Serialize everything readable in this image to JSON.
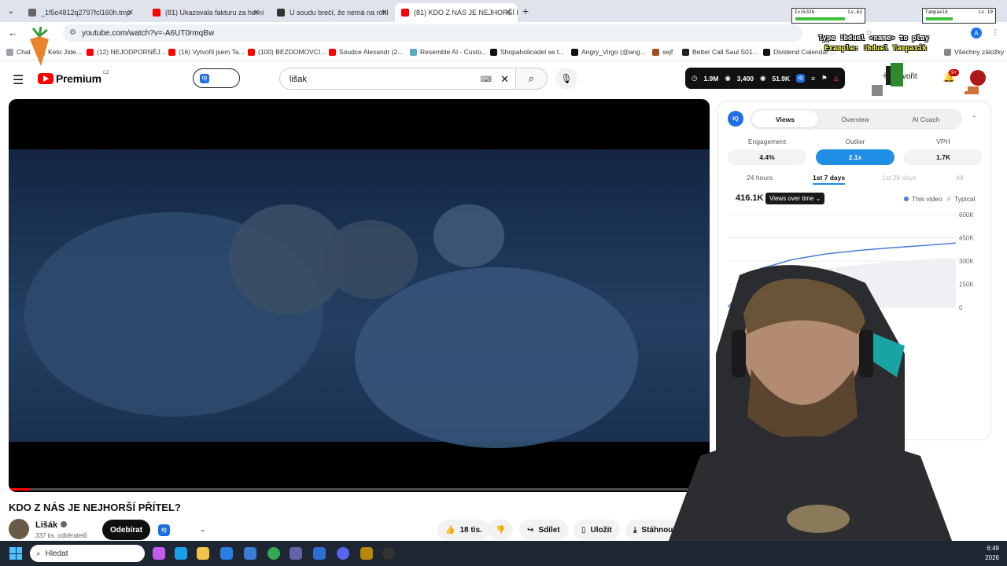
{
  "browser": {
    "tabs": [
      {
        "title": "_1f5o4812q2797fcl160h.tmp",
        "active": false,
        "color": "#666666"
      },
      {
        "title": "(81) Ukazovala fakturu za herní",
        "active": false,
        "color": "#ff0000"
      },
      {
        "title": "U soudu brečí, že nemá na rohl",
        "active": false,
        "color": "#333333"
      },
      {
        "title": "(81) KDO Z NÁS JE NEJHORŠÍ P",
        "active": true,
        "color": "#ff0000"
      }
    ],
    "tab_close": "✕",
    "new_tab": "+",
    "url": "youtube.com/watch?v=-A6UT0rmqBw",
    "profile_initial": "A",
    "bookmarks": [
      {
        "label": "Chat",
        "color": "#9aa0a6"
      },
      {
        "label": "Keto Jíde...",
        "color": "#e07a2e"
      },
      {
        "label": "(12) NEJODPORNĚJ...",
        "color": "#ff0000"
      },
      {
        "label": "(16) Vytvořil jsem Ta...",
        "color": "#ff0000"
      },
      {
        "label": "(100) BEZDOMOVCI...",
        "color": "#ff0000"
      },
      {
        "label": "Soudce Alexandr (2...",
        "color": "#ff0000"
      },
      {
        "label": "Resemble AI - Custo...",
        "color": "#5ab"
      },
      {
        "label": "Shopaholicadel se t...",
        "color": "#111111"
      },
      {
        "label": "Angry_Virgo (@ang...",
        "color": "#111111"
      },
      {
        "label": "sejf",
        "color": "#a05020"
      },
      {
        "label": "Better Call Saul S01...",
        "color": "#222222"
      },
      {
        "label": "Dividend Calendar ...",
        "color": "#111111"
      }
    ],
    "bookmarks_all": "Všechny záložky"
  },
  "youtube": {
    "logo_text": "Premium",
    "logo_region": "CZ",
    "iq_label": "IQ",
    "search_value": "lišak",
    "search_clear": "✕",
    "stats": {
      "views": "1.9M",
      "watching": "3,400",
      "other": "51.9K"
    },
    "create_label": "Vytvořit",
    "notifications_badge": "9+",
    "video": {
      "title": "KDO Z NÁS JE NEJHORŠÍ PŘÍTEL?",
      "progress_fraction": 0.03
    },
    "channel": {
      "name": "Lišák",
      "subscribers": "337 tis. odběratelů",
      "subscribe_label": "Odebírat"
    },
    "actions": {
      "likes": "18 tis.",
      "share": "Sdílet",
      "save": "Uložit",
      "download": "Stáhnout"
    }
  },
  "vidiq": {
    "logo": "IQ",
    "tabs": [
      "Views",
      "Overview",
      "AI Coach"
    ],
    "active_tab": "Views",
    "metrics": [
      {
        "label": "Engagement",
        "value": "4.4%"
      },
      {
        "label": "Outlier",
        "value": "2.1x"
      },
      {
        "label": "VPH",
        "value": "1.7K"
      }
    ],
    "ranges": [
      "24 hours",
      "1st 7 days",
      "1st 28 days",
      "All"
    ],
    "active_range": "1st 7 days",
    "total": "416.1K",
    "dropdown": "Views over time",
    "legend": {
      "this": "This video",
      "typical": "Typical"
    }
  },
  "chart_data": {
    "type": "line",
    "x": [
      0,
      1,
      2,
      3,
      4,
      5,
      6,
      7
    ],
    "series": [
      {
        "name": "This video",
        "values": [
          0,
          250000,
          310000,
          345000,
          368000,
          385000,
          400000,
          416100
        ]
      },
      {
        "name": "Typical",
        "values": [
          0,
          150000,
          210000,
          250000,
          275000,
          295000,
          310000,
          320000
        ]
      }
    ],
    "yticks": [
      "600K",
      "450K",
      "300K",
      "150K",
      "0"
    ],
    "ylim": [
      0,
      600000
    ],
    "grid": true,
    "legend": "top-right"
  },
  "overlay": {
    "player1": {
      "name": "Ivik326",
      "level": "Lv.62",
      "hp_fraction": 0.75
    },
    "player2": {
      "name": "Tampaxik",
      "level": "Lv.19",
      "hp_fraction": 0.4
    },
    "instructions": "Type !bduel <name> to play",
    "example": "Example: !bduel Tampaxik"
  },
  "taskbar": {
    "search_placeholder": "Hledat",
    "time": "6:49",
    "date": "2026"
  },
  "colors": {
    "accent_red": "#ff0000",
    "vidiq_blue": "#1f8fe6",
    "chart_line": "#4a7fd4"
  }
}
